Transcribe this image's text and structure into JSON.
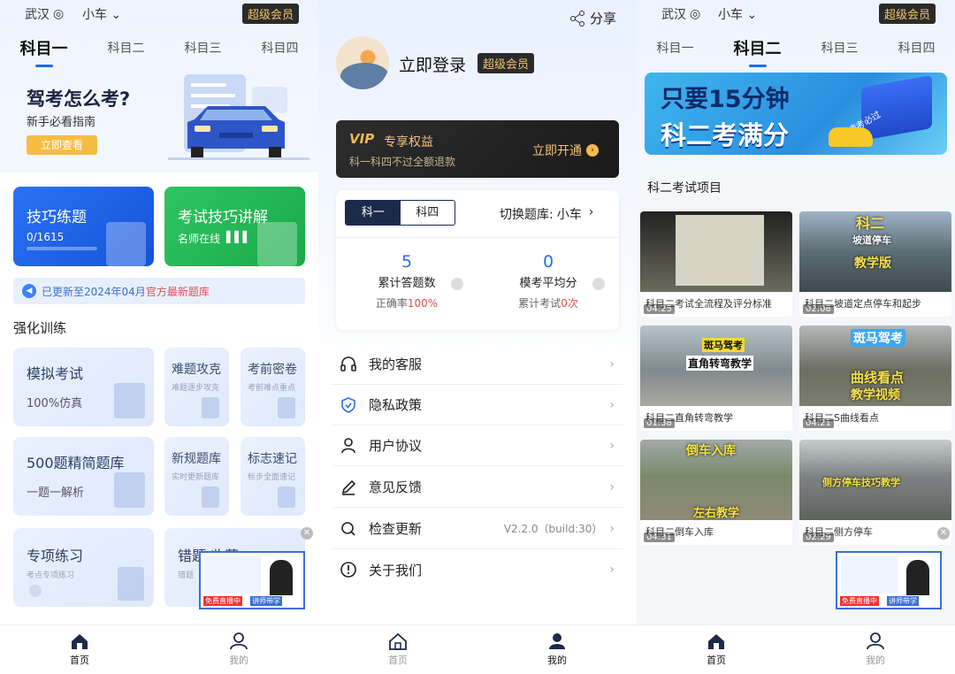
{
  "p1": {
    "city": "武汉",
    "car": "小车",
    "vip": "超级会员",
    "tabs": [
      "科目一",
      "科目二",
      "科目三",
      "科目四"
    ],
    "banner": {
      "title": "驾考怎么考?",
      "subtitle": "新手必看指南",
      "button": "立即查看"
    },
    "tile_skill": {
      "title": "技巧练题",
      "progress": "0/1615"
    },
    "tile_lecture": {
      "title": "考试技巧讲解",
      "sub": "名师在线"
    },
    "notice": {
      "prefix": "已更新至2024年04月",
      "highlight": "官方最新题库"
    },
    "section": "强化训练",
    "cards": [
      {
        "t": "模拟考试",
        "s": "100%仿真"
      },
      {
        "t": "难题攻克",
        "s": "难题逐步攻克"
      },
      {
        "t": "考前密卷",
        "s": "考前难点重点"
      },
      {
        "t": "500题精简题库",
        "s": "一题一解析"
      },
      {
        "t": "新规题库",
        "s": "实时更新题库"
      },
      {
        "t": "标志速记",
        "s": "标步全面速记"
      },
      {
        "t": "专项练习",
        "s": "考点专项练习"
      },
      {
        "t": "错题 收藏",
        "s": "错题"
      }
    ]
  },
  "nav": {
    "home": "首页",
    "mine": "我的"
  },
  "p2": {
    "share": "分享",
    "login": "立即登录",
    "vip": "超级会员",
    "vipcard": {
      "logo": "VIP",
      "title": "专享权益",
      "sub": "科一科四不过全额退款",
      "cta": "立即开通"
    },
    "seg": [
      "科一",
      "科四"
    ],
    "switch_label": "切换题库:",
    "switch_value": "小车",
    "stat1": {
      "num": "5",
      "label": "累计答题数",
      "sub_prefix": "正确率",
      "sub_value": "100%"
    },
    "stat2": {
      "num": "0",
      "label": "模考平均分",
      "sub_prefix": "累计考试",
      "sub_value": "0次"
    },
    "menu": [
      "我的客服",
      "隐私政策",
      "用户协议",
      "意见反馈",
      "检查更新",
      "关于我们"
    ],
    "version": "V2.2.0（build:30）"
  },
  "p3": {
    "city": "武汉",
    "car": "小车",
    "vip": "超级会员",
    "tabs": [
      "科目一",
      "科目二",
      "科目三",
      "科目四"
    ],
    "banner": {
      "line1": "只要15分钟",
      "line2": "科二考满分",
      "tag": "速考必过"
    },
    "section": "科二考试项目",
    "videos": [
      {
        "dur": "04:25",
        "title": "科目二考试全流程及评分标准",
        "ov": ""
      },
      {
        "dur": "02:08",
        "title": "科目二坡道定点停车和起步",
        "ov": "科二",
        "ov2": "坡道停车",
        "ov3": "教学版"
      },
      {
        "dur": "01:38",
        "title": "科目二直角转弯教学",
        "ov": "斑马驾考",
        "ov2": "直角转弯教学"
      },
      {
        "dur": "04:21",
        "title": "科目二S曲线看点",
        "ov": "斑马驾考",
        "ov2": "曲线看点",
        "ov3": "教学视频"
      },
      {
        "dur": "04:31",
        "title": "科目二倒车入库",
        "ov": "倒车入库",
        "ov2": "左右教学"
      },
      {
        "dur": "02:29",
        "title": "科目二侧方停车",
        "ov": "侧方停车技巧教学"
      }
    ]
  },
  "popup": {
    "label": "免费直播中",
    "sub": "讲师带学"
  }
}
